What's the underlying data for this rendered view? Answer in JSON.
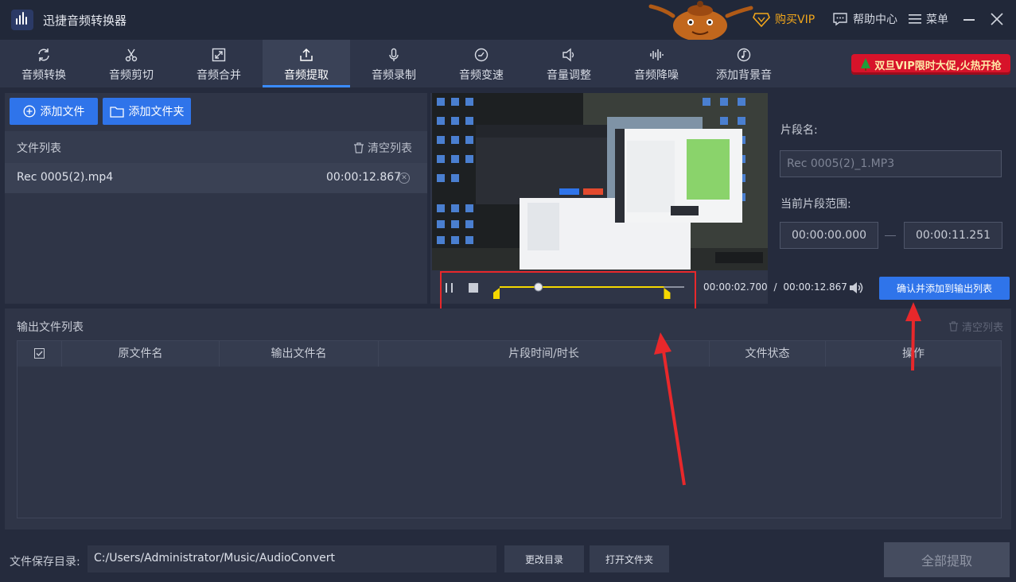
{
  "window": {
    "title": "迅捷音频转换器",
    "vip_label": "购买VIP",
    "help_label": "帮助中心",
    "menu_label": "菜单"
  },
  "tabs": [
    {
      "label": "音频转换",
      "icon": "refresh-icon"
    },
    {
      "label": "音频剪切",
      "icon": "scissors-icon"
    },
    {
      "label": "音频合并",
      "icon": "merge-icon"
    },
    {
      "label": "音频提取",
      "icon": "upload-icon",
      "active": true
    },
    {
      "label": "音频录制",
      "icon": "mic-icon"
    },
    {
      "label": "音频变速",
      "icon": "speedometer-icon"
    },
    {
      "label": "音量调整",
      "icon": "speaker-icon"
    },
    {
      "label": "音频降噪",
      "icon": "waveform-icon"
    },
    {
      "label": "添加背景音",
      "icon": "music-disc-icon"
    }
  ],
  "promo": {
    "label": "双旦VIP限时大促,火热开抢"
  },
  "file_panel": {
    "add_file": "添加文件",
    "add_folder": "添加文件夹",
    "list_title": "文件列表",
    "clear_label": "清空列表",
    "files": [
      {
        "name": "Rec 0005(2).mp4",
        "duration": "00:00:12.867"
      }
    ]
  },
  "player": {
    "current_time": "00:00:02.700",
    "separator": "/",
    "total_time": "00:00:12.867",
    "progress_fraction": 0.21,
    "selection_start_fraction": 0.0,
    "selection_end_fraction": 0.89,
    "confirm_label": "确认并添加到输出列表"
  },
  "segment": {
    "name_label": "片段名:",
    "name_value": "Rec 0005(2)_1.MP3",
    "range_label": "当前片段范围:",
    "start": "00:00:00.000",
    "end": "00:00:11.251"
  },
  "output": {
    "title": "输出文件列表",
    "clear_label": "清空列表",
    "columns": [
      "原文件名",
      "输出文件名",
      "片段时间/时长",
      "文件状态",
      "操作"
    ]
  },
  "bottom": {
    "save_label": "文件保存目录:",
    "path": "C:/Users/Administrator/Music/AudioConvert",
    "change_dir": "更改目录",
    "open_folder": "打开文件夹",
    "extract_all": "全部提取"
  },
  "colors": {
    "accent": "#2f74ea",
    "vip": "#f3a71b",
    "annotation_red": "#e8282b",
    "selection_yellow": "#f5d800"
  }
}
